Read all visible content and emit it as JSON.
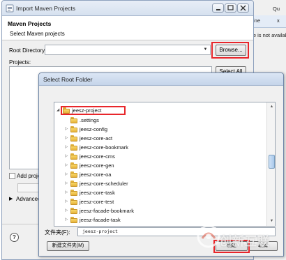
{
  "background_view": {
    "tab_partial_1": "ine",
    "tab_partial_2": "x",
    "top_partial": "Qu",
    "body_text": "ine is not available"
  },
  "maven_window": {
    "title": "Import Maven Projects",
    "heading": "Maven Projects",
    "subheading": "Select Maven projects",
    "root_directory_label": "Root Directory:",
    "root_directory_value": "",
    "browse_label": "Browse...",
    "projects_label": "Projects:",
    "select_all_label": "Select All",
    "add_project_label": "Add proje",
    "advanced_label": "Advanced",
    "help_icon_glyph": "?"
  },
  "select_root_dialog": {
    "title": "Select Root Folder",
    "tree": [
      {
        "label": "jeesz-project",
        "level": 0,
        "expanded": true
      },
      {
        "label": ".settings",
        "level": 1,
        "expanded": false,
        "leaf": true
      },
      {
        "label": "jeesz-config",
        "level": 1,
        "expanded": false
      },
      {
        "label": "jeesz-core-act",
        "level": 1,
        "expanded": false
      },
      {
        "label": "jeesz-core-bookmark",
        "level": 1,
        "expanded": false
      },
      {
        "label": "jeesz-core-cms",
        "level": 1,
        "expanded": false
      },
      {
        "label": "jeesz-core-gen",
        "level": 1,
        "expanded": false
      },
      {
        "label": "jeesz-core-oa",
        "level": 1,
        "expanded": false
      },
      {
        "label": "jeesz-core-scheduler",
        "level": 1,
        "expanded": false
      },
      {
        "label": "jeesz-core-task",
        "level": 1,
        "expanded": false
      },
      {
        "label": "jeesz-core-test",
        "level": 1,
        "expanded": false
      },
      {
        "label": "jeesz-facade-bookmark",
        "level": 1,
        "expanded": false
      },
      {
        "label": "jeesz-facade-task",
        "level": 1,
        "expanded": false
      }
    ],
    "folder_label": "文件夹(F):",
    "folder_value": "jeesz-project",
    "new_folder_label": "新建文件夹(M)",
    "ok_label": "确定",
    "cancel_label": "取消"
  },
  "watermark": {
    "text": "创新互联"
  },
  "colors": {
    "highlight": "#e8262b",
    "titlebar": "#d6e1ef",
    "window_bg": "#f0f0f0"
  }
}
